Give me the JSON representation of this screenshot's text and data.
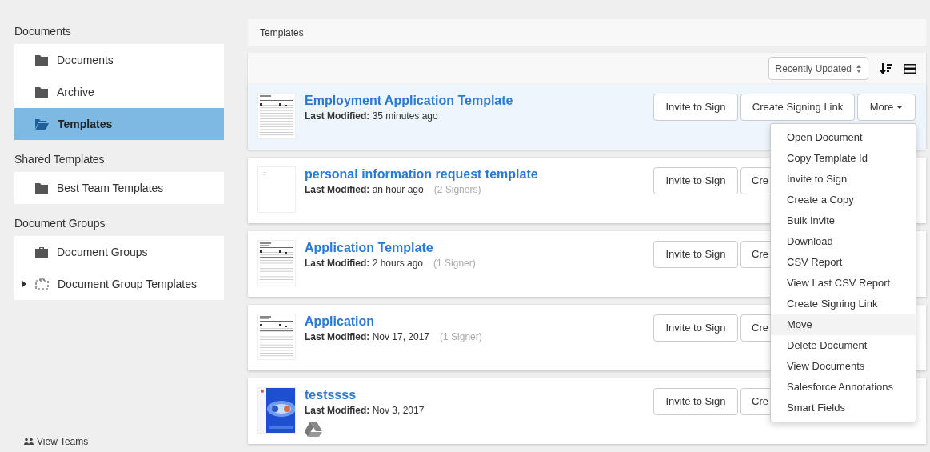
{
  "sidebar": {
    "sections": [
      {
        "heading": "Documents",
        "items": [
          {
            "label": "Documents",
            "kind": "folder",
            "selected": false
          },
          {
            "label": "Archive",
            "kind": "folder",
            "selected": false
          },
          {
            "label": "Templates",
            "kind": "openfolder",
            "selected": true
          }
        ]
      },
      {
        "heading": "Shared Templates",
        "items": [
          {
            "label": "Best Team Templates",
            "kind": "folder",
            "selected": false
          }
        ]
      },
      {
        "heading": "Document Groups",
        "items": [
          {
            "label": "Document Groups",
            "kind": "group",
            "selected": false
          },
          {
            "label": "Document Group Templates",
            "kind": "grouptemplate",
            "selected": false,
            "expanded": false
          }
        ]
      }
    ],
    "footer_link": "View Teams"
  },
  "breadcrumb": "Templates",
  "toolbar": {
    "sort": "Recently Updated"
  },
  "templates": [
    {
      "title": "Employment Application Template",
      "modified_label": "Last Modified:",
      "modified": "35 minutes ago",
      "kind": "form",
      "selected": true,
      "invite_button": "Invite to Sign",
      "link_button": "Create Signing Link",
      "more_button": "More"
    },
    {
      "title": "personal information request template",
      "modified_label": "Last Modified:",
      "modified": "an hour ago",
      "signers": "(2 Signers)",
      "kind": "blank",
      "selected": false,
      "invite_button": "Invite to Sign",
      "link_button": "Cre"
    },
    {
      "title": "Application Template",
      "modified_label": "Last Modified:",
      "modified": "2 hours ago",
      "signers": "(1 Signer)",
      "kind": "form",
      "selected": false,
      "invite_button": "Invite to Sign",
      "link_button": "Cre"
    },
    {
      "title": "Application",
      "modified_label": "Last Modified:",
      "modified": "Nov 17, 2017",
      "signers": "(1 Signer)",
      "kind": "form",
      "selected": false,
      "invite_button": "Invite to Sign",
      "link_button": "Cre"
    },
    {
      "title": "testssss",
      "modified_label": "Last Modified:",
      "modified": "Nov 3, 2017",
      "kind": "picture",
      "drive": true,
      "selected": false,
      "invite_button": "Invite to Sign",
      "link_button": "Cre"
    }
  ],
  "more_menu": [
    {
      "label": "Open Document",
      "highlighted": false
    },
    {
      "label": "Copy Template Id",
      "highlighted": false
    },
    {
      "label": "Invite to Sign",
      "highlighted": false
    },
    {
      "label": "Create a Copy",
      "highlighted": false
    },
    {
      "label": "Bulk Invite",
      "highlighted": false
    },
    {
      "label": "Download",
      "highlighted": false
    },
    {
      "label": "CSV Report",
      "highlighted": false
    },
    {
      "label": "View Last CSV Report",
      "highlighted": false
    },
    {
      "label": "Create Signing Link",
      "highlighted": false
    },
    {
      "label": "Move",
      "highlighted": true
    },
    {
      "label": "Delete Document",
      "highlighted": false
    },
    {
      "label": "View Documents",
      "highlighted": false
    },
    {
      "label": "Salesforce Annotations",
      "highlighted": false
    },
    {
      "label": "Smart Fields",
      "highlighted": false
    }
  ]
}
